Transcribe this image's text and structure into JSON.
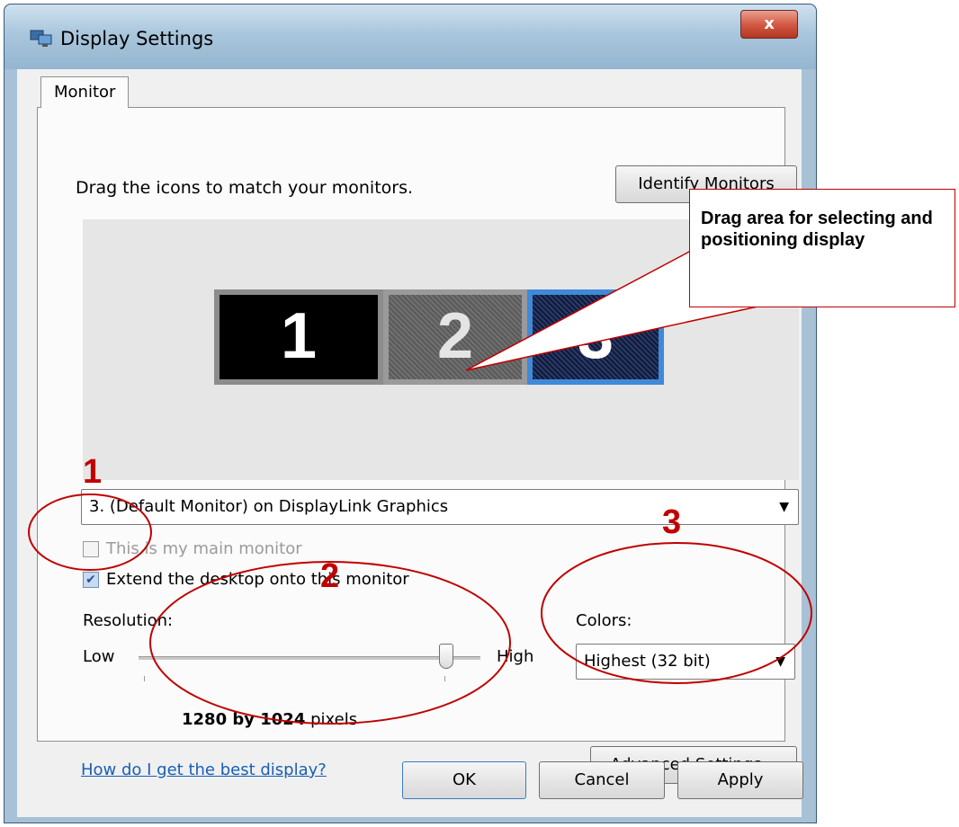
{
  "window": {
    "title": "Display Settings",
    "close_label": "x"
  },
  "tabs": [
    {
      "label": "Monitor"
    }
  ],
  "instruction": "Drag the icons to match your monitors.",
  "identify_button": "Identify Monitors",
  "monitors": [
    {
      "label": "1"
    },
    {
      "label": "2"
    },
    {
      "label": "3"
    }
  ],
  "monitor_select": {
    "value": "3. (Default Monitor) on DisplayLink Graphics"
  },
  "checkboxes": {
    "main": {
      "label": "This is my main monitor",
      "checked": false,
      "enabled": false
    },
    "extend": {
      "label": "Extend the desktop onto this monitor",
      "checked": true
    }
  },
  "resolution": {
    "label": "Resolution:",
    "low": "Low",
    "high": "High",
    "value_bold": "1280 by 1024",
    "value_unit": "pixels",
    "slider_fraction": 0.9
  },
  "colors": {
    "label": "Colors:",
    "value": "Highest (32 bit)"
  },
  "help_link": "How do I get the best display?",
  "advanced_button": "Advanced Settings...",
  "footer": {
    "ok": "OK",
    "cancel": "Cancel",
    "apply": "Apply"
  },
  "annotations": {
    "callout": "Drag area for selecting and positioning display",
    "markers": [
      "1",
      "2",
      "3"
    ],
    "accent_color": "#c00000"
  }
}
